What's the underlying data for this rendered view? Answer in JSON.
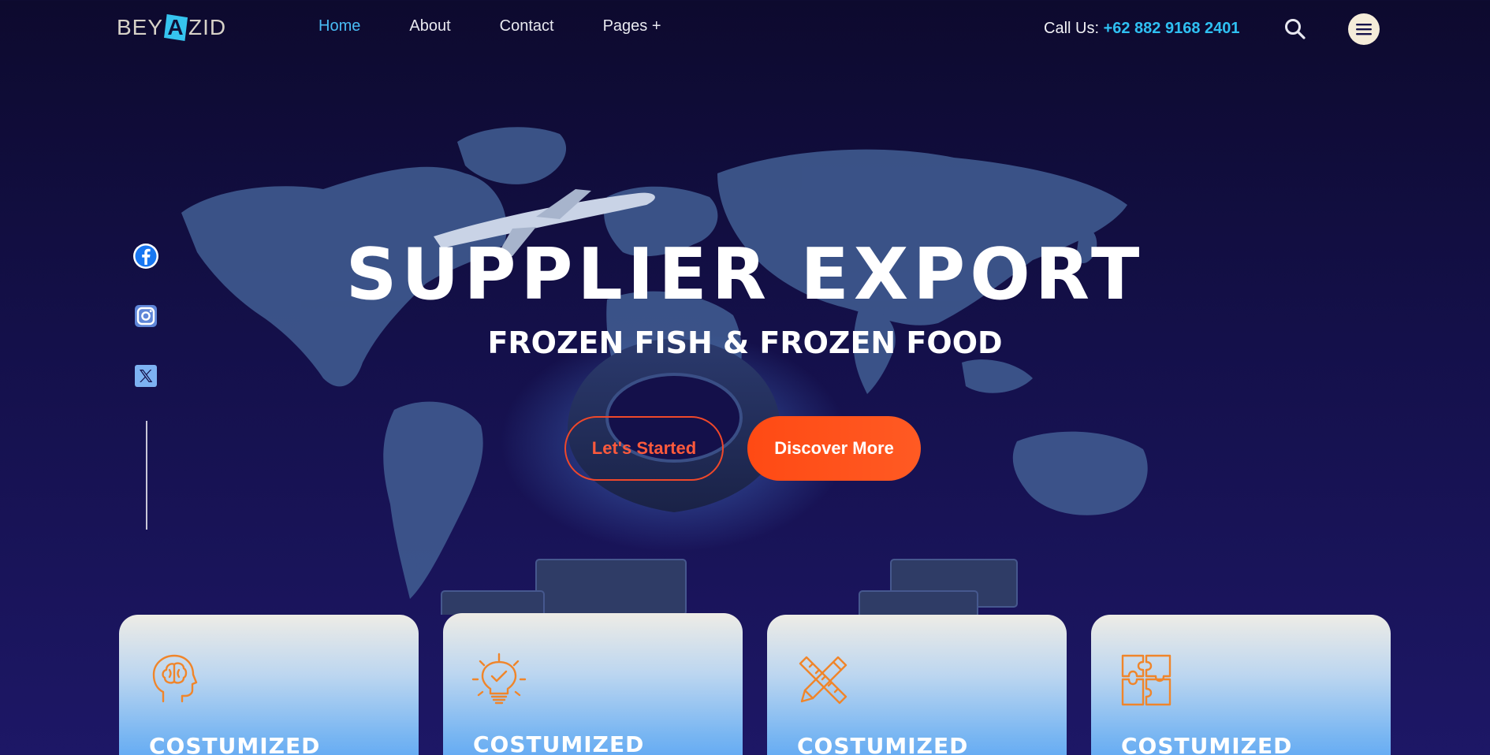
{
  "header": {
    "logo": {
      "left": "BEY",
      "mark": "A",
      "right": "ZID"
    },
    "nav": [
      {
        "label": "Home",
        "active": true
      },
      {
        "label": "About",
        "active": false
      },
      {
        "label": "Contact",
        "active": false
      },
      {
        "label": "Pages +",
        "active": false
      }
    ],
    "call_label": "Call Us:",
    "phone": "+62 882 9168 2401",
    "search_icon": "search-icon",
    "menu_icon": "hamburger-menu-icon"
  },
  "hero": {
    "title": "SUPPLIER EXPORT",
    "subtitle": "FROZEN FISH & FROZEN FOOD",
    "primary_button": "Let's Started",
    "secondary_button": "Discover More"
  },
  "social": [
    {
      "icon": "facebook-icon"
    },
    {
      "icon": "instagram-icon"
    },
    {
      "icon": "x-twitter-icon"
    }
  ],
  "cards": [
    {
      "icon": "brain-head-icon",
      "title": "COSTUMIZED"
    },
    {
      "icon": "lightbulb-check-icon",
      "title": "COSTUMIZED"
    },
    {
      "icon": "pencil-ruler-icon",
      "title": "COSTUMIZED"
    },
    {
      "icon": "puzzle-icon",
      "title": "COSTUMIZED"
    }
  ],
  "colors": {
    "accent_blue": "#49bdf5",
    "phone_blue": "#2fc0f2",
    "cta_orange": "#ff4a14",
    "bg_navy": "#14104a"
  }
}
